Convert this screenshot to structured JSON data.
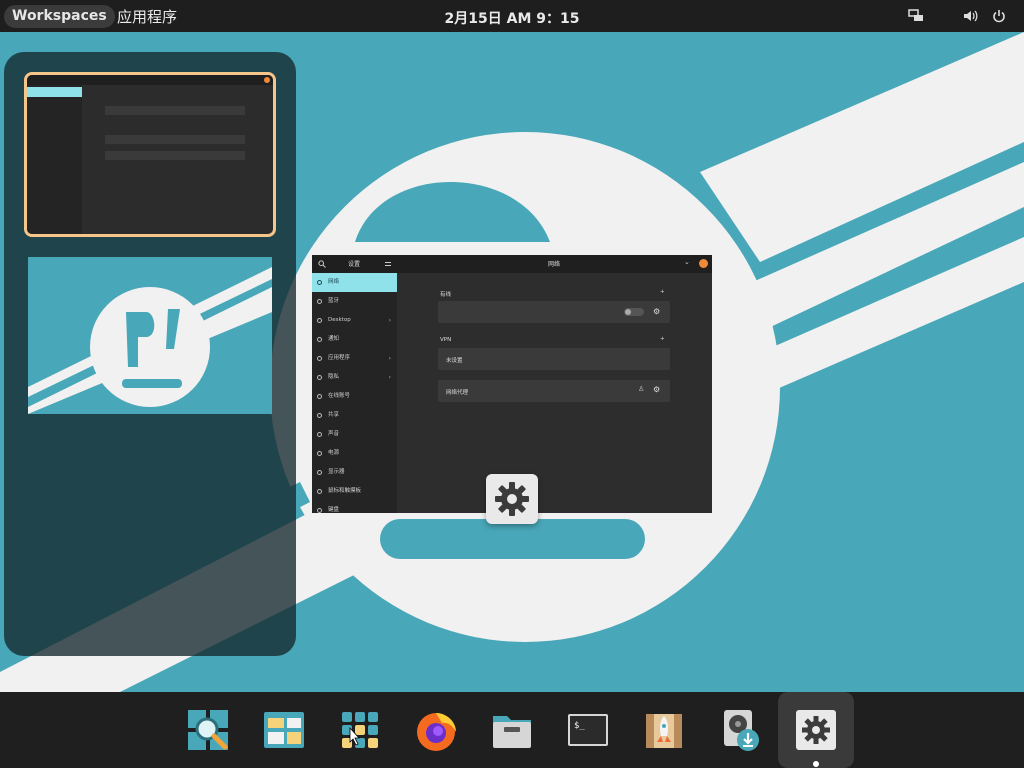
{
  "topbar": {
    "workspaces_label": "Workspaces",
    "apps_label": "应用程序",
    "clock": "2月15日  AM 9：15"
  },
  "window": {
    "title_left": "设置",
    "title_main": "网络",
    "sidebar_items": [
      {
        "label": "网络",
        "active": true,
        "has_arrow": false
      },
      {
        "label": "蓝牙",
        "active": false,
        "has_arrow": false
      },
      {
        "label": "Desktop",
        "active": false,
        "has_arrow": true
      },
      {
        "label": "通知",
        "active": false,
        "has_arrow": false
      },
      {
        "label": "应用程序",
        "active": false,
        "has_arrow": true
      },
      {
        "label": "隐私",
        "active": false,
        "has_arrow": true
      },
      {
        "label": "在线账号",
        "active": false,
        "has_arrow": false
      },
      {
        "label": "共享",
        "active": false,
        "has_arrow": false
      },
      {
        "label": "声音",
        "active": false,
        "has_arrow": false
      },
      {
        "label": "电源",
        "active": false,
        "has_arrow": false
      },
      {
        "label": "显示器",
        "active": false,
        "has_arrow": false
      },
      {
        "label": "鼠标和触摸板",
        "active": false,
        "has_arrow": false
      },
      {
        "label": "键盘",
        "active": false,
        "has_arrow": false
      }
    ],
    "wired_section": "有线",
    "vpn_section": "VPN",
    "vpn_value": "未设置",
    "proxy_label": "网络代理"
  },
  "dock": {
    "items": [
      {
        "name": "search-app",
        "icon": "magnifier-icon"
      },
      {
        "name": "workspaces-app",
        "icon": "windows-icon"
      },
      {
        "name": "applications-app",
        "icon": "app-grid-icon"
      },
      {
        "name": "firefox",
        "icon": "firefox-icon"
      },
      {
        "name": "files",
        "icon": "folder-icon"
      },
      {
        "name": "terminal",
        "icon": "terminal-icon",
        "text": "$_"
      },
      {
        "name": "pop-shop",
        "icon": "shop-icon"
      },
      {
        "name": "installer",
        "icon": "disk-download-icon"
      },
      {
        "name": "settings",
        "icon": "gear-icon",
        "active": true
      }
    ]
  },
  "colors": {
    "wallpaper": "#48a7b8",
    "accent": "#8fe1ea",
    "highlight": "#f6c58a",
    "panel": "#1f1f1f"
  }
}
